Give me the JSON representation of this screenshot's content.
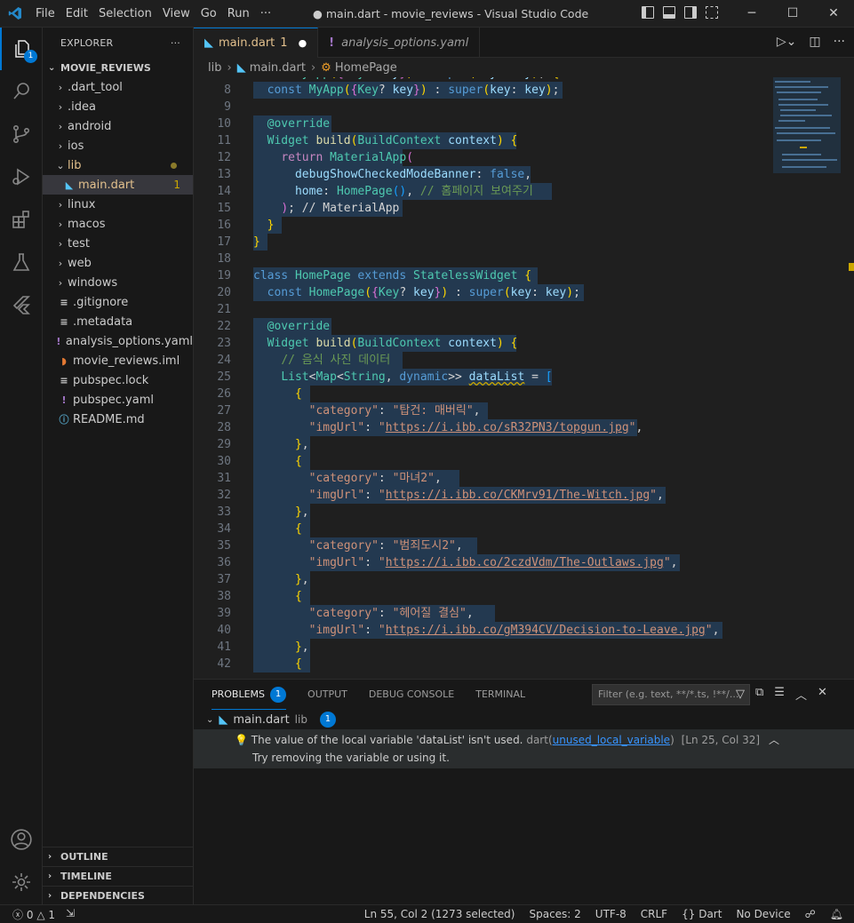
{
  "window": {
    "title": "● main.dart - movie_reviews - Visual Studio Code",
    "menu": [
      "File",
      "Edit",
      "Selection",
      "View",
      "Go",
      "Run",
      "···"
    ]
  },
  "activity": {
    "explorer_badge": "1"
  },
  "sidebar": {
    "header": "EXPLORER",
    "more": "···",
    "root": "MOVIE_REVIEWS",
    "items": [
      {
        "label": ".dart_tool",
        "type": "folder"
      },
      {
        "label": ".idea",
        "type": "folder"
      },
      {
        "label": "android",
        "type": "folder"
      },
      {
        "label": "ios",
        "type": "folder"
      },
      {
        "label": "lib",
        "type": "folder-open"
      },
      {
        "label": "main.dart",
        "type": "file",
        "problems": "1"
      },
      {
        "label": "linux",
        "type": "folder"
      },
      {
        "label": "macos",
        "type": "folder"
      },
      {
        "label": "test",
        "type": "folder"
      },
      {
        "label": "web",
        "type": "folder"
      },
      {
        "label": "windows",
        "type": "folder"
      },
      {
        "label": ".gitignore",
        "type": "file"
      },
      {
        "label": ".metadata",
        "type": "file"
      },
      {
        "label": "analysis_options.yaml",
        "type": "file"
      },
      {
        "label": "movie_reviews.iml",
        "type": "file"
      },
      {
        "label": "pubspec.lock",
        "type": "file"
      },
      {
        "label": "pubspec.yaml",
        "type": "file"
      },
      {
        "label": "README.md",
        "type": "file"
      }
    ],
    "sections": [
      "OUTLINE",
      "TIMELINE",
      "DEPENDENCIES"
    ]
  },
  "editor": {
    "tabs": [
      {
        "label": "main.dart",
        "problems": "1",
        "dirty": "●"
      },
      {
        "label": "analysis_options.yaml"
      }
    ],
    "breadcrumb": [
      "lib",
      "main.dart",
      "HomePage"
    ],
    "line_numbers": [
      "8",
      "9",
      "10",
      "11",
      "12",
      "13",
      "14",
      "15",
      "16",
      "17",
      "18",
      "19",
      "20",
      "21",
      "22",
      "23",
      "24",
      "25",
      "26",
      "27",
      "28",
      "29",
      "30",
      "31",
      "32",
      "33",
      "34",
      "35",
      "36",
      "37",
      "38",
      "39",
      "40",
      "41",
      "42"
    ]
  },
  "panel": {
    "tabs": [
      "PROBLEMS",
      "OUTPUT",
      "DEBUG CONSOLE",
      "TERMINAL"
    ],
    "problems_count": "1",
    "filter_placeholder": "Filter (e.g. text, **/*.ts, !**/...",
    "file": "main.dart",
    "file_dir": "lib",
    "file_count": "1",
    "message": "The value of the local variable 'dataList' isn't used.",
    "source": "dart",
    "code": "unused_local_variable",
    "position": "[Ln 25, Col 32]",
    "hint": "Try removing the variable or using it."
  },
  "statusbar": {
    "errors": "0",
    "warnings": "1",
    "cursor": "Ln 55, Col 2 (1273 selected)",
    "spaces": "Spaces: 2",
    "encoding": "UTF-8",
    "eol": "CRLF",
    "language": "Dart",
    "device": "No Device"
  }
}
